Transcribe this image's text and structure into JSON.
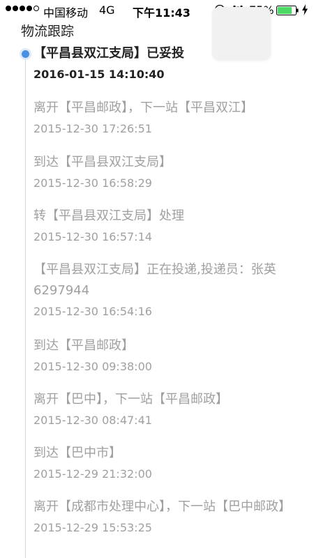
{
  "status_bar": {
    "carrier": "中国移动",
    "network": "4G",
    "time": "下午11:43",
    "battery_percent": "75%",
    "signal_bars": 4,
    "icons": [
      "orientation-lock-icon",
      "alarm-clock-icon",
      "battery-icon",
      "charging-bolt-icon"
    ]
  },
  "page": {
    "title": "物流跟踪"
  },
  "timeline": {
    "entries": [
      {
        "status": "【平昌县双江支局】已妥投",
        "time": "2016-01-15 14:10:40"
      },
      {
        "status": "离开【平昌邮政】，下一站【平昌双江】",
        "time": "2015-12-30 17:26:51"
      },
      {
        "status": "到达【平昌县双江支局】",
        "time": "2015-12-30 16:58:29"
      },
      {
        "status": "转【平昌县双江支局】处理",
        "time": "2015-12-30 16:57:14"
      },
      {
        "status": "【平昌县双江支局】正在投递,投递员：张英 6297944",
        "time": "2015-12-30 16:54:16"
      },
      {
        "status": "到达【平昌邮政】",
        "time": "2015-12-30 09:38:00"
      },
      {
        "status": "离开【巴中】，下一站【平昌邮政】",
        "time": "2015-12-30 08:47:41"
      },
      {
        "status": "到达【巴中市】",
        "time": "2015-12-29 21:32:00"
      },
      {
        "status": "离开【成都市处理中心】，下一站【巴中邮政】",
        "time": "2015-12-29 15:53:25"
      }
    ]
  },
  "colors": {
    "current_dot": "#4a90e2",
    "active_text": "#222222",
    "past_text": "#a0a0a0",
    "timeline_line": "#d8d8d8"
  }
}
